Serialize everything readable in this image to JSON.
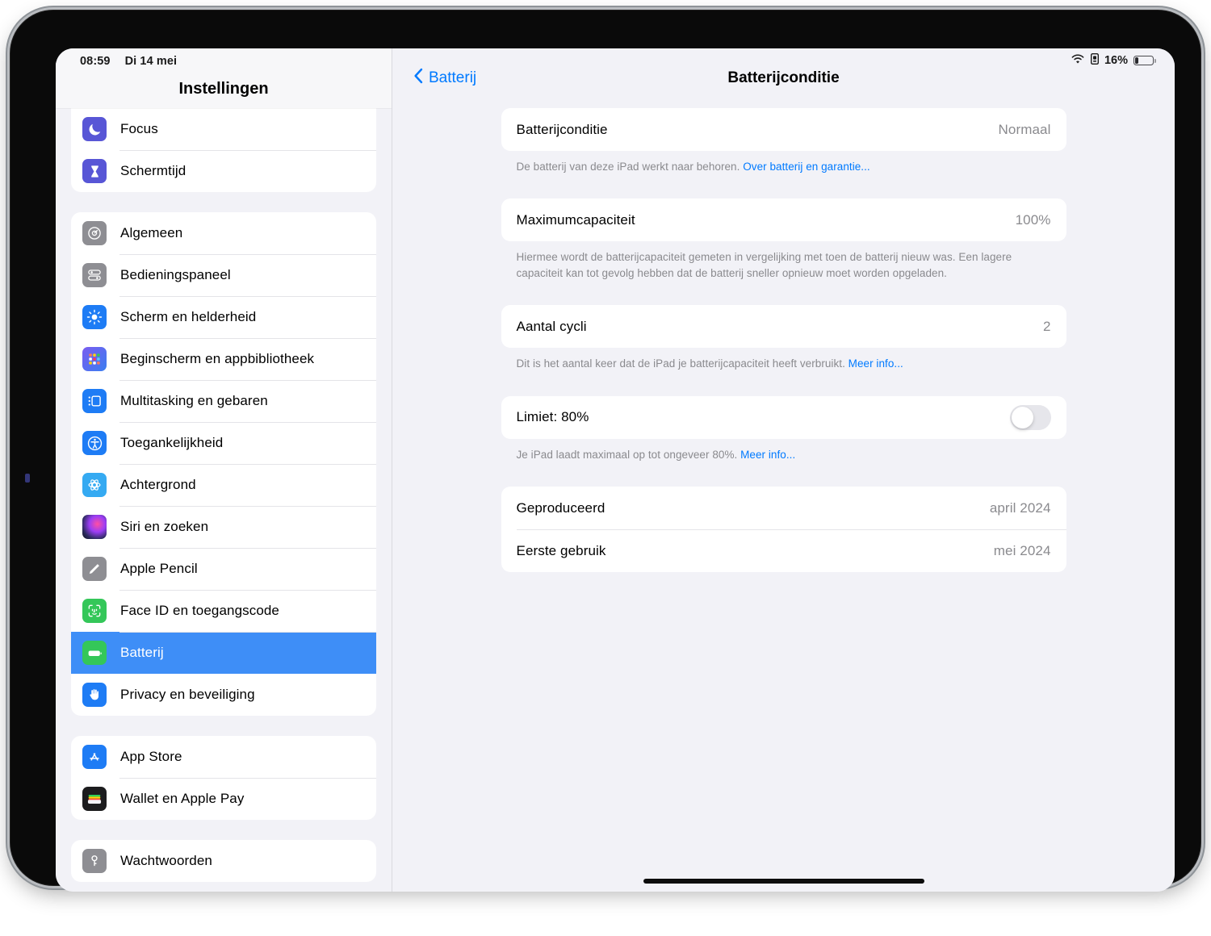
{
  "status_bar": {
    "time": "08:59",
    "date": "Di 14 mei",
    "battery_percent": "16%",
    "wifi_icon": "wifi-icon",
    "lock_icon": "battery-lock-icon",
    "battery_icon": "battery-icon",
    "battery_level": 16
  },
  "sidebar": {
    "title": "Instellingen",
    "groups": [
      {
        "items": [
          {
            "label": "Focus",
            "icon": "moon-icon",
            "icon_class": "ic-purple",
            "selected": false
          },
          {
            "label": "Schermtijd",
            "icon": "hourglass-icon",
            "icon_class": "ic-purple",
            "selected": false
          }
        ]
      },
      {
        "items": [
          {
            "label": "Algemeen",
            "icon": "gear-icon",
            "icon_class": "ic-grey",
            "selected": false
          },
          {
            "label": "Bedieningspaneel",
            "icon": "sliders-icon",
            "icon_class": "ic-grey",
            "selected": false
          },
          {
            "label": "Scherm en helderheid",
            "icon": "brightness-icon",
            "icon_class": "ic-blue",
            "selected": false
          },
          {
            "label": "Beginscherm en appbibliotheek",
            "icon": "app-grid-icon",
            "icon_class": "ic-home",
            "selected": false
          },
          {
            "label": "Multitasking en gebaren",
            "icon": "multitasking-icon",
            "icon_class": "ic-blue",
            "selected": false
          },
          {
            "label": "Toegankelijkheid",
            "icon": "accessibility-icon",
            "icon_class": "ic-blue",
            "selected": false
          },
          {
            "label": "Achtergrond",
            "icon": "wallpaper-icon",
            "icon_class": "ic-lblue",
            "selected": false
          },
          {
            "label": "Siri en zoeken",
            "icon": "siri-icon",
            "icon_class": "ic-siri",
            "selected": false
          },
          {
            "label": "Apple Pencil",
            "icon": "pencil-icon",
            "icon_class": "ic-grey",
            "selected": false
          },
          {
            "label": "Face ID en toegangscode",
            "icon": "face-id-icon",
            "icon_class": "ic-green",
            "selected": false
          },
          {
            "label": "Batterij",
            "icon": "battery-icon",
            "icon_class": "ic-green",
            "selected": true
          },
          {
            "label": "Privacy en beveiliging",
            "icon": "hand-icon",
            "icon_class": "ic-blue",
            "selected": false
          }
        ]
      },
      {
        "items": [
          {
            "label": "App Store",
            "icon": "app-store-icon",
            "icon_class": "ic-blue",
            "selected": false
          },
          {
            "label": "Wallet en Apple Pay",
            "icon": "wallet-icon",
            "icon_class": "ic-dark",
            "selected": false
          }
        ]
      },
      {
        "items": [
          {
            "label": "Wachtwoorden",
            "icon": "key-icon",
            "icon_class": "ic-grey",
            "selected": false
          }
        ]
      }
    ]
  },
  "nav": {
    "back_label": "Batterij",
    "back_icon": "chevron-left-icon",
    "title": "Batterijconditie"
  },
  "main": {
    "battery_health": {
      "label": "Batterijconditie",
      "value": "Normaal",
      "footnote_text": "De batterij van deze iPad werkt naar behoren. ",
      "footnote_link": "Over batterij en garantie..."
    },
    "max_capacity": {
      "label": "Maximumcapaciteit",
      "value": "100%",
      "footnote_text": "Hiermee wordt de batterijcapaciteit gemeten in vergelijking met toen de batterij nieuw was. Een lagere capaciteit kan tot gevolg hebben dat de batterij sneller opnieuw moet worden opgeladen."
    },
    "cycle_count": {
      "label": "Aantal cycli",
      "value": "2",
      "footnote_text": "Dit is het aantal keer dat de iPad je batterijcapaciteit heeft verbruikt. ",
      "footnote_link": "Meer info..."
    },
    "charge_limit": {
      "label": "Limiet: 80%",
      "toggle_on": false,
      "footnote_text": "Je iPad laadt maximaal op tot ongeveer 80%. ",
      "footnote_link": "Meer info..."
    },
    "dates": {
      "manufactured_label": "Geproduceerd",
      "manufactured_value": "april 2024",
      "first_use_label": "Eerste gebruik",
      "first_use_value": "mei 2024"
    }
  },
  "colors": {
    "accent_blue": "#007aff",
    "selection_blue": "#3e8ef7",
    "page_bg": "#f2f2f7",
    "card_bg": "#ffffff",
    "secondary_text": "#8a8a8e"
  }
}
